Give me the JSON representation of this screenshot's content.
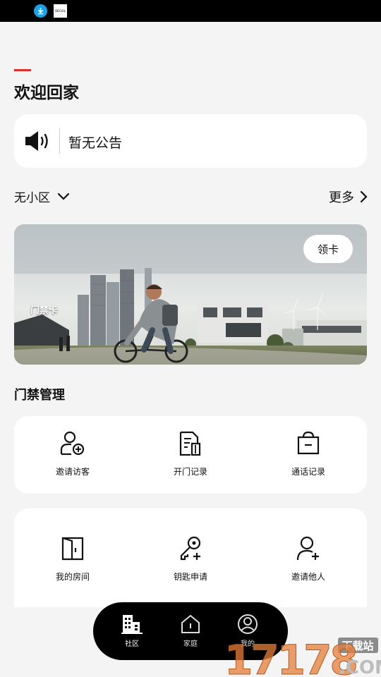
{
  "status_bar": {
    "icons": [
      "download-icon",
      "app-notification-icon"
    ],
    "app_icon_text": "DECUIL"
  },
  "welcome": {
    "title": "欢迎回家"
  },
  "notice": {
    "icon": "speaker-icon",
    "text": "暂无公告"
  },
  "community": {
    "selected": "无小区",
    "more_label": "更多"
  },
  "banner": {
    "label": "门禁卡",
    "button_label": "领卡"
  },
  "access": {
    "section_title": "门禁管理",
    "items": [
      {
        "label": "邀请访客",
        "icon": "invite-visitor-icon"
      },
      {
        "label": "开门记录",
        "icon": "door-record-icon"
      },
      {
        "label": "通话记录",
        "icon": "call-record-icon"
      }
    ]
  },
  "home_items": [
    {
      "label": "我的房间",
      "icon": "room-door-icon"
    },
    {
      "label": "钥匙申请",
      "icon": "key-apply-icon"
    },
    {
      "label": "邀请他人",
      "icon": "invite-person-icon"
    }
  ],
  "tabbar": {
    "tabs": [
      {
        "label": "社区",
        "icon": "building-icon",
        "active": true
      },
      {
        "label": "家庭",
        "icon": "home-icon",
        "active": false
      },
      {
        "label": "我的",
        "icon": "profile-icon",
        "active": false
      }
    ]
  },
  "watermark": {
    "number": "17178",
    "site": ".COM",
    "badge": "下载站"
  },
  "colors": {
    "accent": "#e52d2d",
    "background": "#f4f4f4",
    "card": "#ffffff",
    "tabbar": "#000000",
    "watermark": "#e57f3a"
  }
}
